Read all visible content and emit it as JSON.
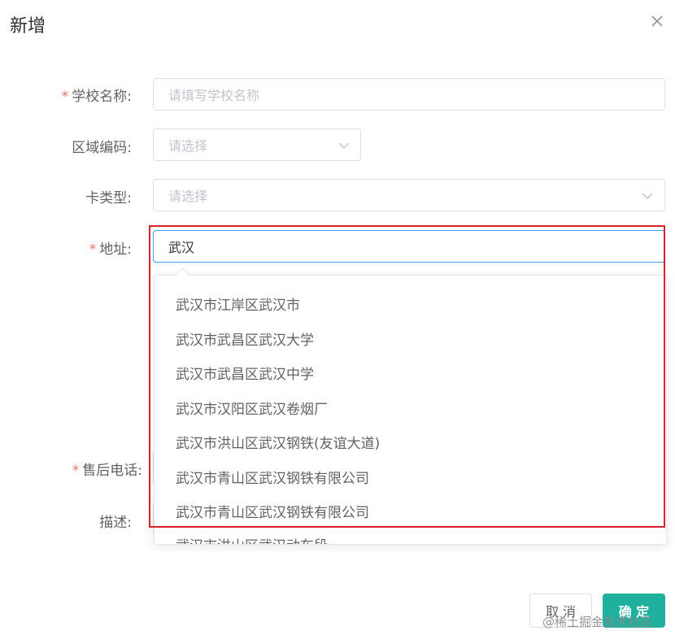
{
  "dialog": {
    "title": "新增"
  },
  "form": {
    "school_name": {
      "label": "学校名称:",
      "required": true,
      "placeholder": "请填写学校名称"
    },
    "region_code": {
      "label": "区域编码:",
      "required": false,
      "placeholder": "请选择"
    },
    "card_type": {
      "label": "卡类型:",
      "required": false,
      "placeholder": "请选择"
    },
    "address": {
      "label": "地址:",
      "required": true,
      "value": "武汉"
    },
    "after_sales_phone": {
      "label": "售后电话:",
      "required": true
    },
    "description": {
      "label": "描述:",
      "required": false
    },
    "required_mark": "*"
  },
  "address_suggestions": [
    "武汉市江岸区武汉市",
    "武汉市武昌区武汉大学",
    "武汉市武昌区武汉中学",
    "武汉市汉阳区武汉卷烟厂",
    "武汉市洪山区武汉钢铁(友谊大道)",
    "武汉市青山区武汉钢铁有限公司",
    "武汉市青山区武汉钢铁有限公司",
    "武汉市洪山区武汉动车段"
  ],
  "footer": {
    "cancel_label": "取 消",
    "ok_label": "确 定"
  },
  "watermark": "@稀土掘金技术社区",
  "colors": {
    "primary": "#1fb19e",
    "focus_border": "#409eff",
    "required": "#f56c6c",
    "highlight_box": "#d9222a"
  },
  "icons": {
    "close": "close-icon",
    "select_arrow": "chevron-down-icon"
  }
}
